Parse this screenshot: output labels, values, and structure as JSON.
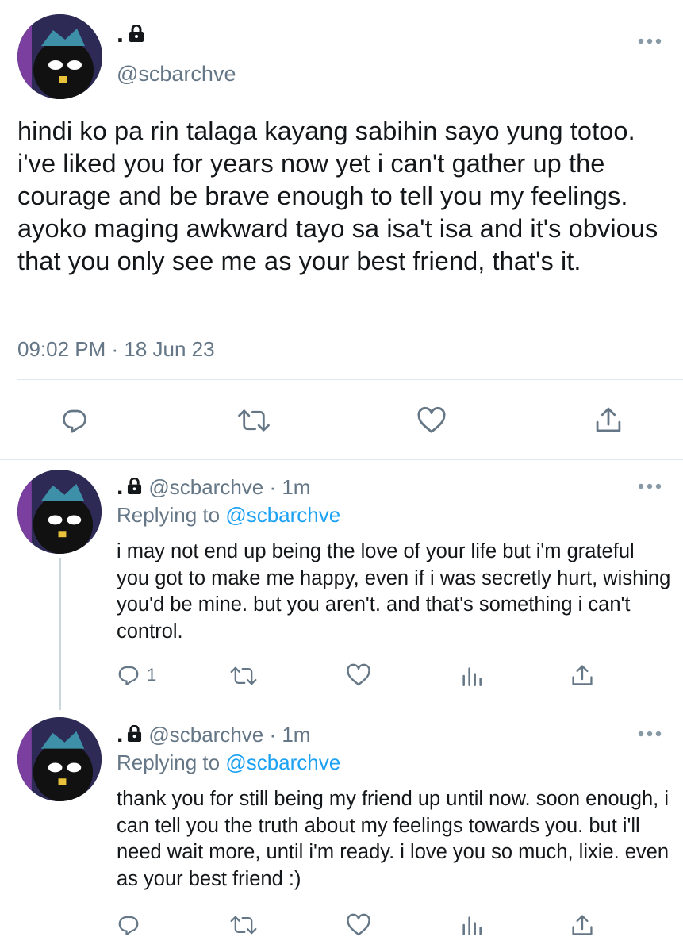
{
  "main_tweet": {
    "display_name": ".",
    "handle": "@scbarchve",
    "text": "hindi ko pa rin talaga kayang sabihin sayo yung totoo. i've liked you for years now yet i can't gather up the courage and be brave enough to tell you my feelings. ayoko maging awkward tayo sa isa't isa and it's obvious that you only see me as your best friend, that's it.",
    "timestamp": "09:02 PM · 18 Jun 23"
  },
  "replies": [
    {
      "display_name": ".",
      "handle_time": "@scbarchve · 1m",
      "replying_prefix": "Replying to ",
      "replying_to": "@scbarchve",
      "text": "i may not end up being the love of your life but i'm grateful you got to make me happy, even if i was secretly hurt, wishing you'd be mine. but you aren't. and that's something i can't control.",
      "reply_count": "1"
    },
    {
      "display_name": ".",
      "handle_time": "@scbarchve · 1m",
      "replying_prefix": "Replying to ",
      "replying_to": "@scbarchve",
      "text": "thank you for still being my friend up until now. soon enough, i can tell you the truth about my feelings towards you. but i'll need wait more, until i'm ready. i love you so much, lixie. even as your best friend :)",
      "reply_count": ""
    }
  ],
  "colors": {
    "text": "#14171a",
    "secondary": "#657786",
    "mention": "#1da1f2",
    "divider": "#e1e8ed"
  },
  "icons": [
    "lock-icon",
    "more-icon",
    "reply-icon",
    "retweet-icon",
    "like-icon",
    "share-icon",
    "analytics-icon"
  ]
}
